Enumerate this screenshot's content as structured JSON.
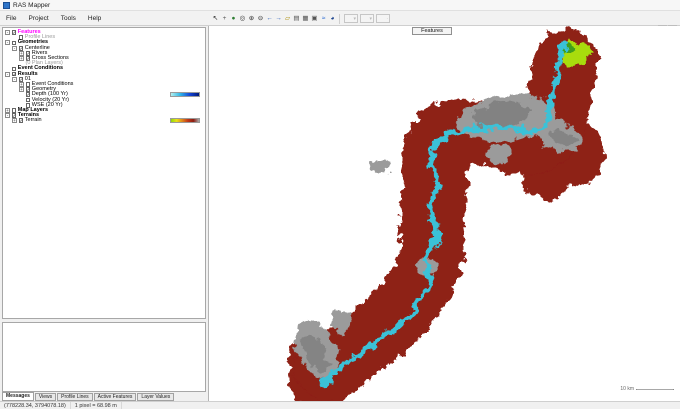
{
  "window": {
    "title": "RAS Mapper",
    "child_window_controls": [
      {
        "name": "minimize-map-window",
        "glyph": "–"
      },
      {
        "name": "restore-map-window",
        "glyph": "□"
      }
    ]
  },
  "menu": {
    "items": [
      "File",
      "Project",
      "Tools",
      "Help"
    ]
  },
  "toolbar": {
    "tools": [
      {
        "name": "select-tool",
        "glyph": "↖",
        "color": "#222222"
      },
      {
        "name": "pan-tool",
        "glyph": "+",
        "color": "#555555"
      },
      {
        "name": "zoom-extents",
        "glyph": "●",
        "color": "#2e7d32"
      },
      {
        "name": "zoom-window",
        "glyph": "◎",
        "color": "#333333"
      },
      {
        "name": "zoom-in",
        "glyph": "⊕",
        "color": "#333333"
      },
      {
        "name": "zoom-out",
        "glyph": "⊖",
        "color": "#333333"
      },
      {
        "name": "previous-view",
        "glyph": "←",
        "color": "#2b5fb8"
      },
      {
        "name": "next-view",
        "glyph": "→",
        "color": "#2b5fb8"
      },
      {
        "name": "measure-tool",
        "glyph": "▱",
        "color": "#a98b00"
      },
      {
        "name": "plot-table",
        "glyph": "▤",
        "color": "#555555"
      },
      {
        "name": "plot-grid",
        "glyph": "▦",
        "color": "#555555"
      },
      {
        "name": "print-map",
        "glyph": "▣",
        "color": "#555555"
      },
      {
        "name": "profile-lines-tool",
        "glyph": "≈",
        "color": "#1b5fd0"
      },
      {
        "name": "web-imagery",
        "glyph": "◕",
        "color": "#123b8a"
      }
    ],
    "disabled_controls": [
      {
        "name": "animation-combo",
        "glyph": "▾"
      },
      {
        "name": "profile-combo",
        "glyph": "▾"
      },
      {
        "name": "animation-step-button",
        "glyph": "·"
      }
    ]
  },
  "layer_tree": {
    "items": [
      {
        "label": "Features",
        "depth": 0,
        "expander": "-",
        "checked": true,
        "accent": true,
        "bold": true
      },
      {
        "label": "Profile Lines",
        "depth": 1,
        "expander": null,
        "checked": false,
        "grayed": true
      },
      {
        "label": "Geometries",
        "depth": 0,
        "expander": "-",
        "checked": false,
        "bold": true
      },
      {
        "label": "Centerline",
        "depth": 1,
        "expander": "-",
        "checked": true
      },
      {
        "label": "Rivers",
        "depth": 2,
        "expander": "+",
        "checked": true
      },
      {
        "label": "Cross Sections",
        "depth": 2,
        "expander": "+",
        "checked": true
      },
      {
        "label": "(0 Plan Layers)",
        "depth": 2,
        "expander": null,
        "checked": null,
        "grayed": true
      },
      {
        "label": "Event Conditions",
        "depth": 0,
        "expander": null,
        "checked": false,
        "bold": true
      },
      {
        "label": "Results",
        "depth": 0,
        "expander": "-",
        "checked": true,
        "bold": true
      },
      {
        "label": "01",
        "depth": 1,
        "expander": "-",
        "checked": true
      },
      {
        "label": "Event Conditions",
        "depth": 2,
        "expander": "+",
        "checked": false
      },
      {
        "label": "Geometry",
        "depth": 2,
        "expander": "+",
        "checked": true
      },
      {
        "label": "Depth (100 Yr)",
        "depth": 2,
        "expander": null,
        "checked": true,
        "legend": "depth"
      },
      {
        "label": "Velocity (20 Yr)",
        "depth": 2,
        "expander": null,
        "checked": false
      },
      {
        "label": "WSE (20 Yr)",
        "depth": 2,
        "expander": null,
        "checked": false
      },
      {
        "label": "Map Layers",
        "depth": 0,
        "expander": "+",
        "checked": false,
        "bold": true
      },
      {
        "label": "Terrains",
        "depth": 0,
        "expander": "-",
        "checked": true,
        "bold": true
      },
      {
        "label": "Terrain",
        "depth": 1,
        "expander": "+",
        "checked": true,
        "legend": "terrain"
      }
    ],
    "check_glyph": "✓"
  },
  "legends": {
    "depth_stops": [
      "#b4f0ee",
      "#30b6e8",
      "#1545d8",
      "#001a7a"
    ],
    "terrain_stops": [
      "#8ed60e",
      "#e8e414",
      "#e0861c",
      "#c23818",
      "#8c1c10",
      "#aaaaaa"
    ]
  },
  "map": {
    "active_layer_label": "Features",
    "scale_bar_label": "10 km"
  },
  "bottom_tabs": [
    "Messages",
    "Views",
    "Profile Lines",
    "Active Features",
    "Layer Values"
  ],
  "selected_tab": "Messages",
  "status_bar": {
    "coordinates": "(778228.34, 3794078.18)",
    "pixel_scale": "1 pixel = 68.98 m"
  },
  "colors": {
    "accent_magenta": "#ff00ff",
    "band_maroon": "#8e2015",
    "band_orange": "#cf6a1c",
    "band_yellow": "#d8d014",
    "band_green": "#3f9e1d",
    "band_lime": "#a8dc10",
    "river_blue": "#1646cf",
    "river_cyan": "#3ac2d8",
    "hillshade_gray": "#9b9b9b",
    "hillshade_dark": "#6e6e6e"
  }
}
